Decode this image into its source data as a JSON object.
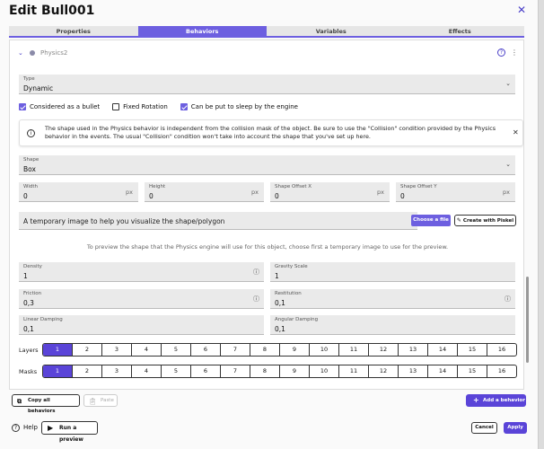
{
  "window": {
    "title": "Edit Bull001"
  },
  "tabs": [
    {
      "label": "Properties",
      "active": false
    },
    {
      "label": "Behaviors",
      "active": true
    },
    {
      "label": "Variables",
      "active": false
    },
    {
      "label": "Effects",
      "active": false
    }
  ],
  "behavior": {
    "name": "Physics2"
  },
  "type_field": {
    "label": "Type",
    "value": "Dynamic"
  },
  "checkboxes": [
    {
      "label": "Considered as a bullet",
      "checked": true
    },
    {
      "label": "Fixed Rotation",
      "checked": false
    },
    {
      "label": "Can be put to sleep by the engine",
      "checked": true
    }
  ],
  "info": {
    "text": "The shape used in the Physics behavior is independent from the collision mask of the object. Be sure to use the \"Collision\" condition provided by the Physics behavior in the events. The usual \"Collision\" condition won't take into account the shape that you've set up here."
  },
  "shape_field": {
    "label": "Shape",
    "value": "Box"
  },
  "dimensions": [
    {
      "label": "Width",
      "value": "0",
      "unit": "px"
    },
    {
      "label": "Height",
      "value": "0",
      "unit": "px"
    },
    {
      "label": "Shape Offset X",
      "value": "0",
      "unit": "px"
    },
    {
      "label": "Shape Offset Y",
      "value": "0",
      "unit": "px"
    }
  ],
  "temp_image": {
    "text": "A temporary image to help you visualize the shape/polygon",
    "choose_label": "Choose a file",
    "piskel_label": "Create with Piskel",
    "hint": "To preview the shape that the Physics engine will use for this object, choose first a temporary image to use for the preview."
  },
  "physics_fields": {
    "density": {
      "label": "Density",
      "value": "1"
    },
    "gravity_scale": {
      "label": "Gravity Scale",
      "value": "1"
    },
    "friction": {
      "label": "Friction",
      "value": "0,3"
    },
    "restitution": {
      "label": "Restitution",
      "value": "0,1"
    },
    "linear_damping": {
      "label": "Linear Damping",
      "value": "0,1"
    },
    "angular_damping": {
      "label": "Angular Damping",
      "value": "0,1"
    }
  },
  "layers": {
    "label": "Layers",
    "items": [
      "1",
      "2",
      "3",
      "4",
      "5",
      "6",
      "7",
      "8",
      "9",
      "10",
      "11",
      "12",
      "13",
      "14",
      "15",
      "16"
    ],
    "selected": "1"
  },
  "masks": {
    "label": "Masks",
    "items": [
      "1",
      "2",
      "3",
      "4",
      "5",
      "6",
      "7",
      "8",
      "9",
      "10",
      "11",
      "12",
      "13",
      "14",
      "15",
      "16"
    ],
    "selected": "1"
  },
  "toolbar": {
    "copy_label": "Copy all behaviors",
    "paste_label": "Paste",
    "add_label": "Add a behavior"
  },
  "footer": {
    "help_label": "Help",
    "preview_label": "Run a preview",
    "cancel_label": "Cancel",
    "apply_label": "Apply"
  },
  "colors": {
    "accent": "#6d5fe0",
    "accent_dark": "#5a44d8"
  }
}
